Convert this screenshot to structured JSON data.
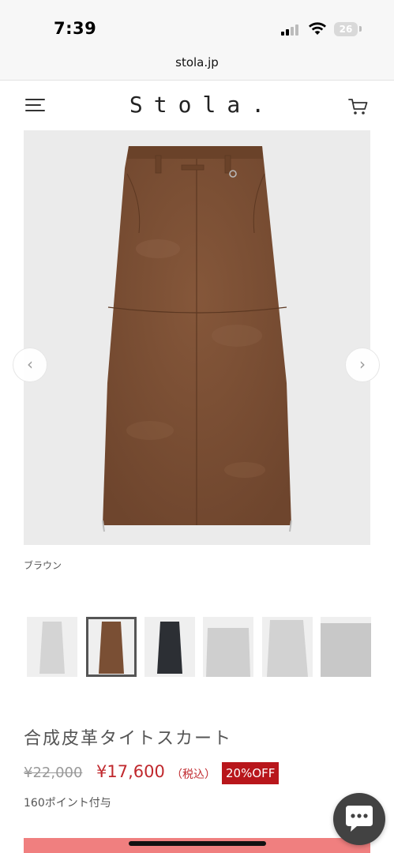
{
  "status_bar": {
    "time": "7:39",
    "battery": "26",
    "icons": [
      "signal-icon",
      "wifi-icon",
      "battery-icon"
    ]
  },
  "browser": {
    "url": "stola.jp"
  },
  "header": {
    "logo": "Stola.",
    "icons": [
      "menu-icon",
      "cart-icon"
    ]
  },
  "gallery": {
    "prev_icon": "‹",
    "next_icon": "›",
    "color_label": "ブラウン",
    "thumbnails": [
      {
        "color": "#d4d4d4",
        "selected": false
      },
      {
        "color": "#7a4f34",
        "selected": true
      },
      {
        "color": "#2c2f34",
        "selected": false
      },
      {
        "color": "#cfcfcf",
        "selected": false
      },
      {
        "color": "#d2d2d2",
        "selected": false
      },
      {
        "color": "#c8c8c8",
        "selected": false
      }
    ]
  },
  "product": {
    "name": "合成皮革タイトスカート",
    "old_price": "¥22,000",
    "price": "¥17,600",
    "tax_label": "（税込）",
    "discount": "20%OFF",
    "points": "160ポイント付与"
  },
  "colors": {
    "accent_red": "#c0282d",
    "badge_red": "#b8161b",
    "cta_pink": "#f07f7f",
    "skirt_brown": "#7a4f34",
    "chat_bg": "#424242"
  }
}
